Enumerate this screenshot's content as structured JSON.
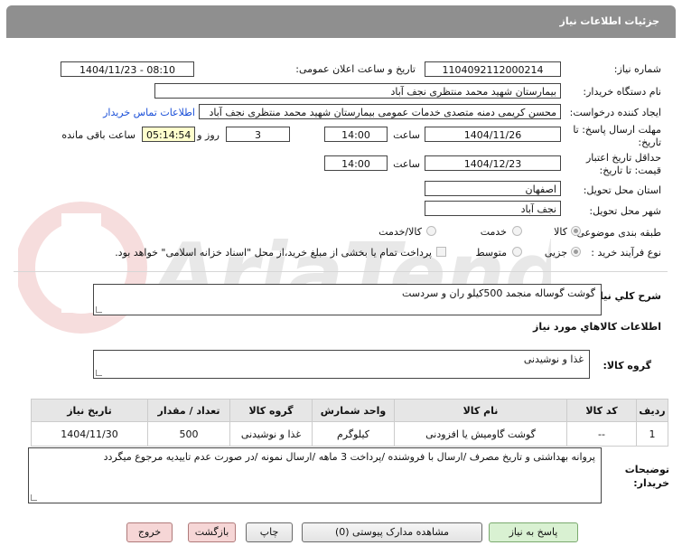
{
  "header": {
    "title": "جزئیات اطلاعات نیاز"
  },
  "fields": {
    "need_number_label": "شماره نیاز:",
    "need_number": "1104092112000214",
    "announce_label": "تاریخ و ساعت اعلان عمومی:",
    "announce_value": "1404/11/23 - 08:10",
    "buyer_org_label": "نام دستگاه خریدار:",
    "buyer_org": "بیمارستان شهید محمد منتظری نجف آباد",
    "creator_label": "ایجاد کننده درخواست:",
    "creator": "محسن کریمی دمنه متصدی خدمات عمومی بیمارستان شهید محمد منتظری نجف آباد",
    "contact_link": "اطلاعات تماس خریدار",
    "reply_deadline_label": "مهلت ارسال پاسخ: تا تاریخ:",
    "reply_date": "1404/11/26",
    "time_label": "ساعت",
    "reply_time": "14:00",
    "days_value": "3",
    "days_label": "روز و",
    "remaining_time": "05:14:54",
    "remaining_label": "ساعت باقی مانده",
    "price_validity_label": "حداقل تاریخ اعتبار قیمت: تا تاریخ:",
    "price_date": "1404/12/23",
    "price_time": "14:00",
    "province_label": "استان محل تحویل:",
    "province": "اصفهان",
    "city_label": "شهر محل تحویل:",
    "city": "نجف آباد",
    "category_label": "طبقه بندی موضوعی:",
    "category_options": [
      "کالا",
      "خدمت",
      "کالا/خدمت"
    ],
    "process_label": "نوع فرآیند خرید :",
    "process_options": [
      "جزیی",
      "متوسط"
    ],
    "payment_note": "پرداخت تمام یا بخشی از مبلغ خرید،از محل \"اسناد خزانه اسلامی\" خواهد بود."
  },
  "description": {
    "label": "شرح كلي نياز:",
    "value": "گوشت گوساله منجمد 500کیلو ران و سردست"
  },
  "goods": {
    "section_title": "اطلاعات كالاهاي مورد نياز",
    "group_label": "گروه کالا:",
    "group_value": "غذا و نوشیدنی",
    "columns": [
      "ردیف",
      "کد کالا",
      "نام کالا",
      "واحد شمارش",
      "گروه کالا",
      "تعداد / مقدار",
      "تاریخ نیاز"
    ],
    "rows": [
      [
        "1",
        "--",
        "گوشت گاومیش یا افزودنی",
        "کیلوگرم",
        "غذا و نوشیدنی",
        "500",
        "1404/11/30"
      ]
    ]
  },
  "notes": {
    "label": "توضیحات خریدار:",
    "value": "پروانه بهداشتی و تاریخ مصرف /ارسال با فروشنده /پرداخت 3 ماهه /ارسال نمونه /در صورت  عدم تاییدیه مرجوع میگردد"
  },
  "buttons": {
    "reply": "پاسخ به نیاز",
    "attachments": "مشاهده مدارک پیوستی (0)",
    "print": "چاپ",
    "back": "بازگشت",
    "exit": "خروج"
  },
  "watermark": "AriaTender.neT",
  "colors": {
    "header_bg": "#8f8f8f",
    "link": "#1a4fd8",
    "remaining_bg": "#ffffcc",
    "reply_btn": "#d9f1d2",
    "exit_btn": "#f6d6d6"
  }
}
